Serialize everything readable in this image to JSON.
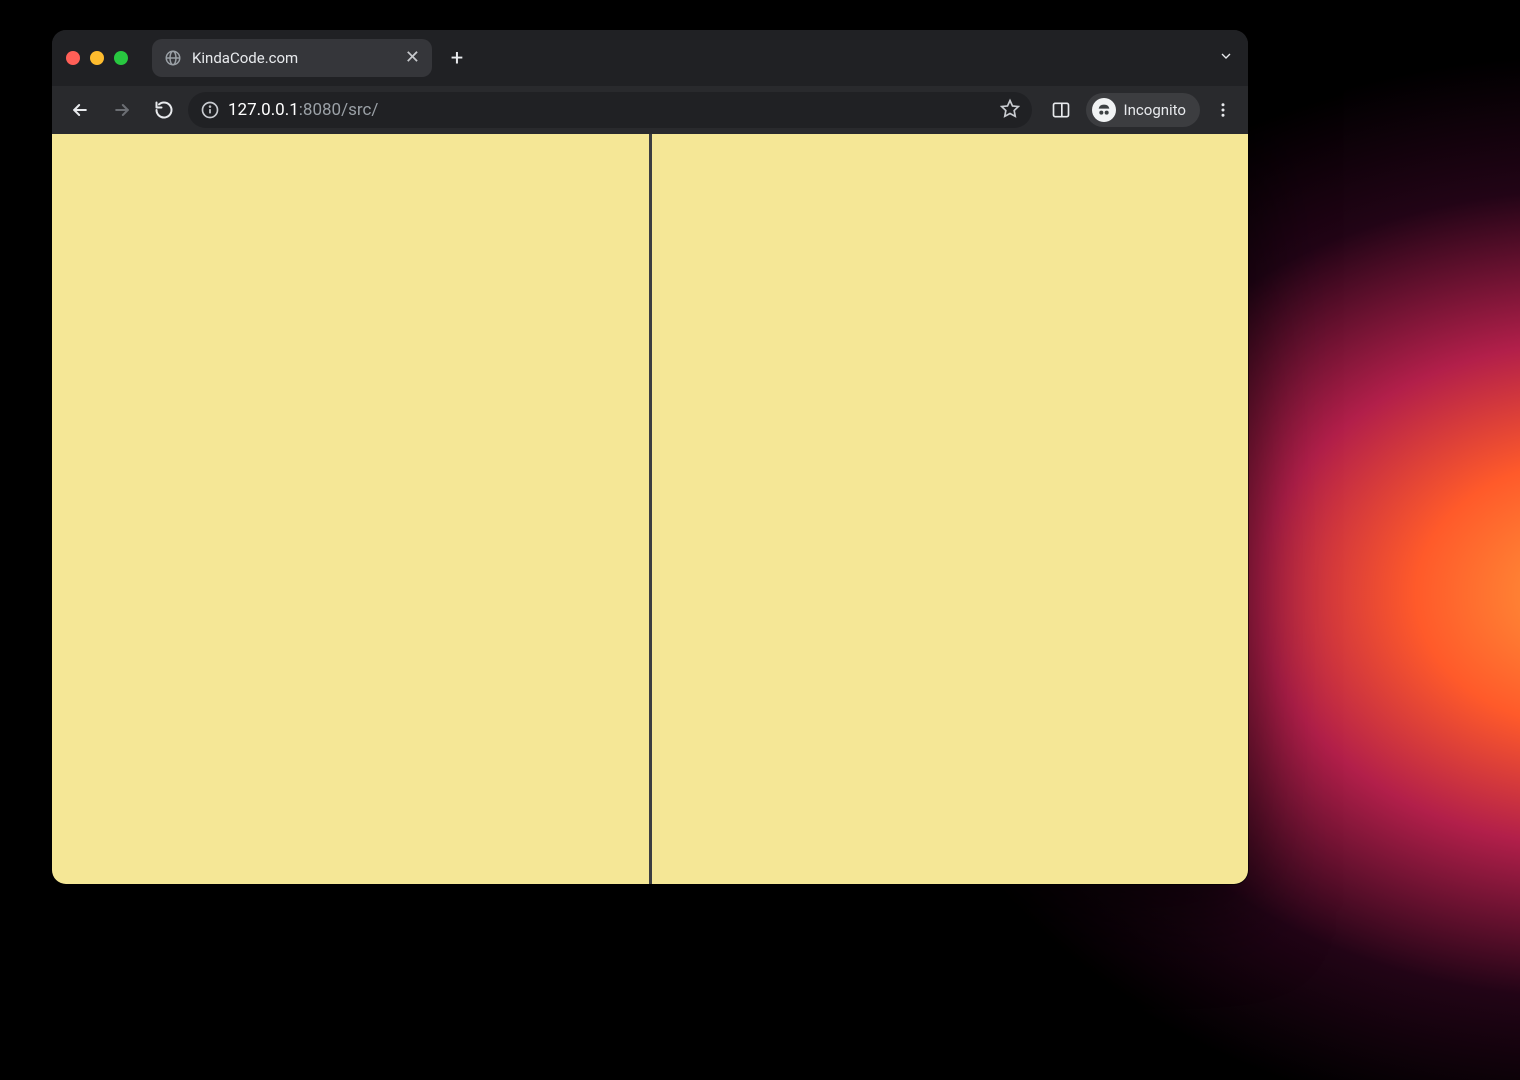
{
  "window": {
    "tab_title": "KindaCode.com"
  },
  "address_bar": {
    "host": "127.0.0.1",
    "port_path": ":8080/src/"
  },
  "profile": {
    "label": "Incognito"
  },
  "content": {
    "bg_color": "#f5e796"
  }
}
